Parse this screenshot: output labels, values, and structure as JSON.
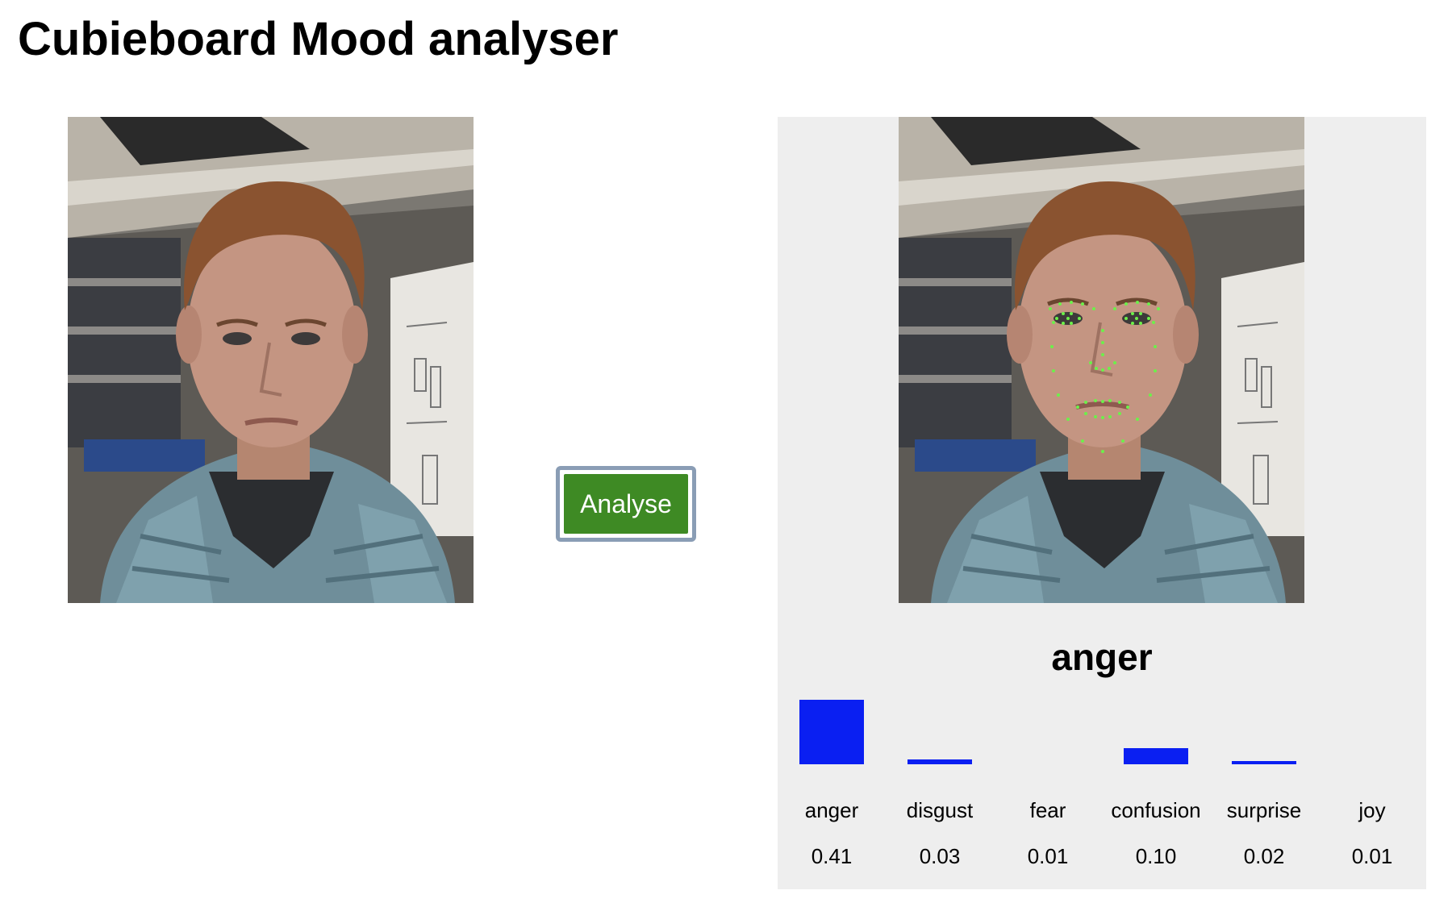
{
  "page": {
    "title": "Cubieboard Mood analyser"
  },
  "input_image": {
    "description_icon": "face-photo"
  },
  "analyse_button": {
    "label": "Analyse"
  },
  "result": {
    "mood": "anger",
    "scores": [
      {
        "name": "anger",
        "value": "0.41"
      },
      {
        "name": "disgust",
        "value": "0.03"
      },
      {
        "name": "fear",
        "value": "0.01"
      },
      {
        "name": "confusion",
        "value": "0.10"
      },
      {
        "name": "surprise",
        "value": "0.02"
      },
      {
        "name": "joy",
        "value": "0.01"
      }
    ]
  },
  "colors": {
    "button": "#3e8a24",
    "bar": "#0a1ff2",
    "landmarks": "#6cf04a",
    "panel": "#eeeeee"
  }
}
